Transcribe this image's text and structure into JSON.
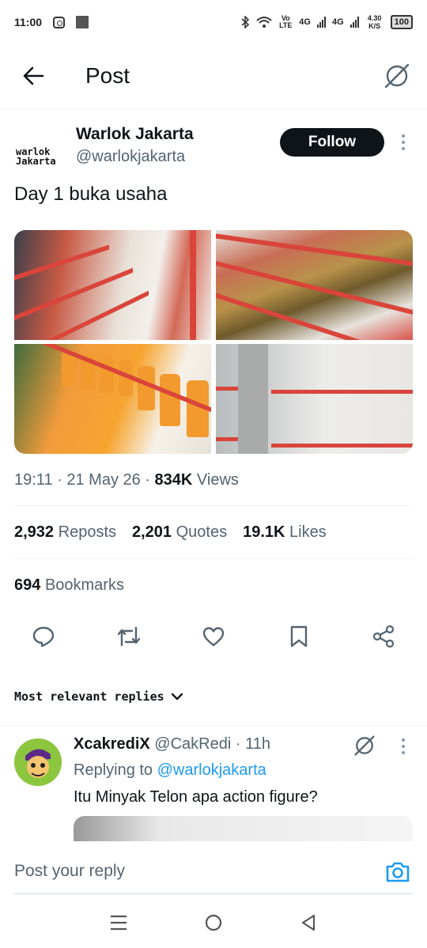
{
  "status_bar": {
    "time": "11:00",
    "network_label": "Vo LTE",
    "signal1": "4G",
    "signal2": "4G",
    "speed": "4.30 K/S",
    "battery": "100"
  },
  "header": {
    "title": "Post"
  },
  "author": {
    "logo_line1": "warlok",
    "logo_line2": "Jakarta",
    "name": "Warlok Jakarta",
    "handle": "@warlokjakarta",
    "follow_label": "Follow"
  },
  "post": {
    "text": "Day 1 buka usaha",
    "time": "19:11",
    "date": "21 May 26",
    "views_count": "834K",
    "views_label": "Views"
  },
  "stats": {
    "reposts_count": "2,932",
    "reposts_label": "Reposts",
    "quotes_count": "2,201",
    "quotes_label": "Quotes",
    "likes_count": "19.1K",
    "likes_label": "Likes",
    "bookmarks_count": "694",
    "bookmarks_label": "Bookmarks"
  },
  "replies_sort": {
    "label": "Most relevant replies"
  },
  "reply": {
    "name": "XcakrediX",
    "handle": "@CakRedi",
    "time": "11h",
    "replying_prefix": "Replying to",
    "replying_handle": "@warlokjakarta",
    "text": "Itu Minyak Telon apa action figure?"
  },
  "composer": {
    "placeholder": "Post your reply"
  },
  "colors": {
    "accent": "#1d9bf0",
    "text": "#0f1419",
    "muted": "#536471"
  }
}
